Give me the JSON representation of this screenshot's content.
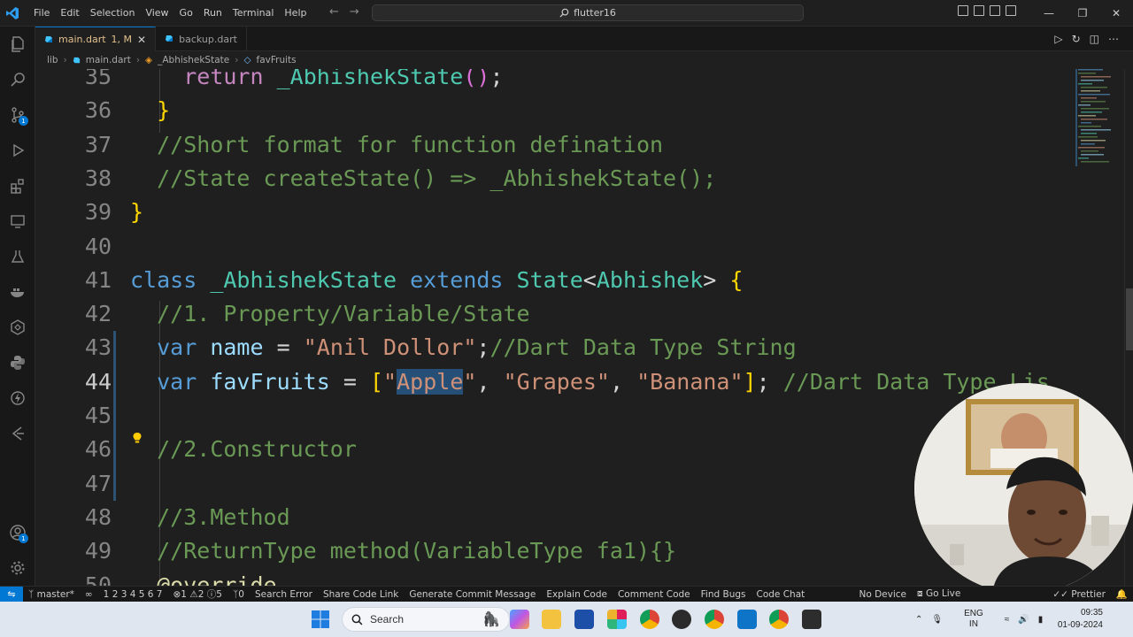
{
  "titlebar": {
    "menu": [
      "File",
      "Edit",
      "Selection",
      "View",
      "Go",
      "Run",
      "Terminal",
      "Help"
    ],
    "command_center": "flutter16",
    "window_controls": [
      "minimize-icon",
      "restore-icon",
      "close-icon"
    ]
  },
  "tabs": [
    {
      "label": "main.dart",
      "status": "1, M",
      "active": true
    },
    {
      "label": "backup.dart",
      "active": false
    }
  ],
  "breadcrumb": [
    "lib",
    "main.dart",
    "_AbhishekState",
    "favFruits"
  ],
  "editor": {
    "current_line": 44,
    "selected_text": "Apple",
    "lines": [
      {
        "n": "35",
        "text": "    return _AbhishekState();"
      },
      {
        "n": "36",
        "text": "  }"
      },
      {
        "n": "37",
        "text": "  //Short format for function defination"
      },
      {
        "n": "38",
        "text": "  //State createState() => _AbhishekState();"
      },
      {
        "n": "39",
        "text": "}"
      },
      {
        "n": "40",
        "text": ""
      },
      {
        "n": "41",
        "text": "class _AbhishekState extends State<Abhishek> {"
      },
      {
        "n": "42",
        "text": "  //1. Property/Variable/State"
      },
      {
        "n": "43",
        "text": "  var name = \"Anil Dollor\";//Dart Data Type String"
      },
      {
        "n": "44",
        "text": "  var favFruits = [\"Apple\", \"Grapes\", \"Banana\"]; //Dart Data Type Lis"
      },
      {
        "n": "45",
        "text": ""
      },
      {
        "n": "46",
        "text": "  //2.Constructor"
      },
      {
        "n": "47",
        "text": ""
      },
      {
        "n": "48",
        "text": "  //3.Method"
      },
      {
        "n": "49",
        "text": "  //ReturnType method(VariableType fa1){}"
      },
      {
        "n": "50",
        "text": "  @override"
      }
    ]
  },
  "statusbar": {
    "branch": "master*",
    "ports": "1 2 3 4 5 6 7",
    "problems": "1",
    "warnings": "2",
    "info": "5",
    "ports_count": "0",
    "items": [
      "Search Error",
      "Share Code Link",
      "Generate Commit Message",
      "Explain Code",
      "Comment Code",
      "Find Bugs",
      "Code Chat"
    ],
    "right_items": [
      "No Device",
      "Go Live",
      "Prettier"
    ]
  },
  "taskbar": {
    "search_placeholder": "Search",
    "language": "ENG",
    "region": "IN",
    "time": "09:35",
    "date": "01-09-2024"
  },
  "colors": {
    "accent": "#0078d4",
    "editor_bg": "#1f1f1f",
    "keyword": "#569cd6",
    "type": "#4ec9b0",
    "string": "#ce9178",
    "comment": "#6a9955"
  }
}
